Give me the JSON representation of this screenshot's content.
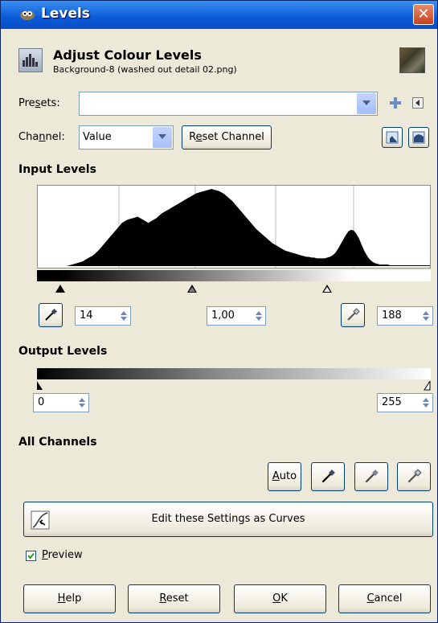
{
  "window": {
    "title": "Levels",
    "close": "✕"
  },
  "header": {
    "title": "Adjust Colour Levels",
    "subtitle": "Background-8 (washed out detail 02.png)"
  },
  "presets": {
    "label_pre": "Pre",
    "label_u": "s",
    "label_post": "ets:",
    "value": ""
  },
  "channel": {
    "label_pre": "Cha",
    "label_u": "n",
    "label_post": "nel:",
    "value": "Value",
    "reset_pre": "R",
    "reset_u": "e",
    "reset_post": "set Channel"
  },
  "input_levels": {
    "heading": "Input Levels",
    "low": "14",
    "gamma": "1,00",
    "high": "188"
  },
  "output_levels": {
    "heading": "Output Levels",
    "low": "0",
    "high": "255"
  },
  "all_channels": {
    "heading": "All Channels",
    "auto_u": "A",
    "auto_post": "uto"
  },
  "curves_button": "Edit these Settings as Curves",
  "preview": {
    "u": "P",
    "post": "review",
    "checked": true
  },
  "buttons": {
    "help_u": "H",
    "help_post": "elp",
    "reset_u": "R",
    "reset_post": "eset",
    "ok_u": "O",
    "ok_post": "K",
    "cancel_u": "C",
    "cancel_post": "ancel"
  },
  "colors": {
    "titlebar": "#0a5ad8",
    "dialog_bg": "#ece9d8",
    "close": "#c8401f"
  },
  "histogram": {
    "description_values": [
      0,
      0,
      0,
      0,
      0,
      0,
      0,
      0,
      0,
      0,
      0,
      0,
      1,
      2,
      3,
      4,
      5,
      6,
      8,
      10,
      12,
      14,
      17,
      20,
      24,
      28,
      32,
      36,
      40,
      44,
      48,
      52,
      56,
      58,
      60,
      61,
      62,
      63,
      64,
      62,
      60,
      58,
      56,
      58,
      60,
      62,
      65,
      68,
      70,
      72,
      74,
      76,
      78,
      80,
      82,
      84,
      86,
      88,
      90,
      92,
      94,
      95,
      96,
      97,
      98,
      99,
      100,
      99,
      98,
      97,
      95,
      93,
      90,
      87,
      84,
      80,
      76,
      72,
      68,
      64,
      60,
      56,
      52,
      48,
      45,
      42,
      39,
      36,
      33,
      30,
      28,
      26,
      24,
      22,
      20,
      19,
      18,
      17,
      16,
      15,
      14,
      13,
      12,
      12,
      11,
      11,
      10,
      10,
      10,
      10,
      11,
      12,
      14,
      17,
      22,
      28,
      34,
      40,
      45,
      47,
      46,
      42,
      36,
      28,
      20,
      14,
      9,
      6,
      4,
      3,
      2,
      2,
      2,
      2,
      1,
      1,
      1,
      1,
      1,
      1,
      1,
      1,
      1,
      1,
      1,
      1,
      1,
      1,
      1,
      1
    ],
    "max": 100
  }
}
